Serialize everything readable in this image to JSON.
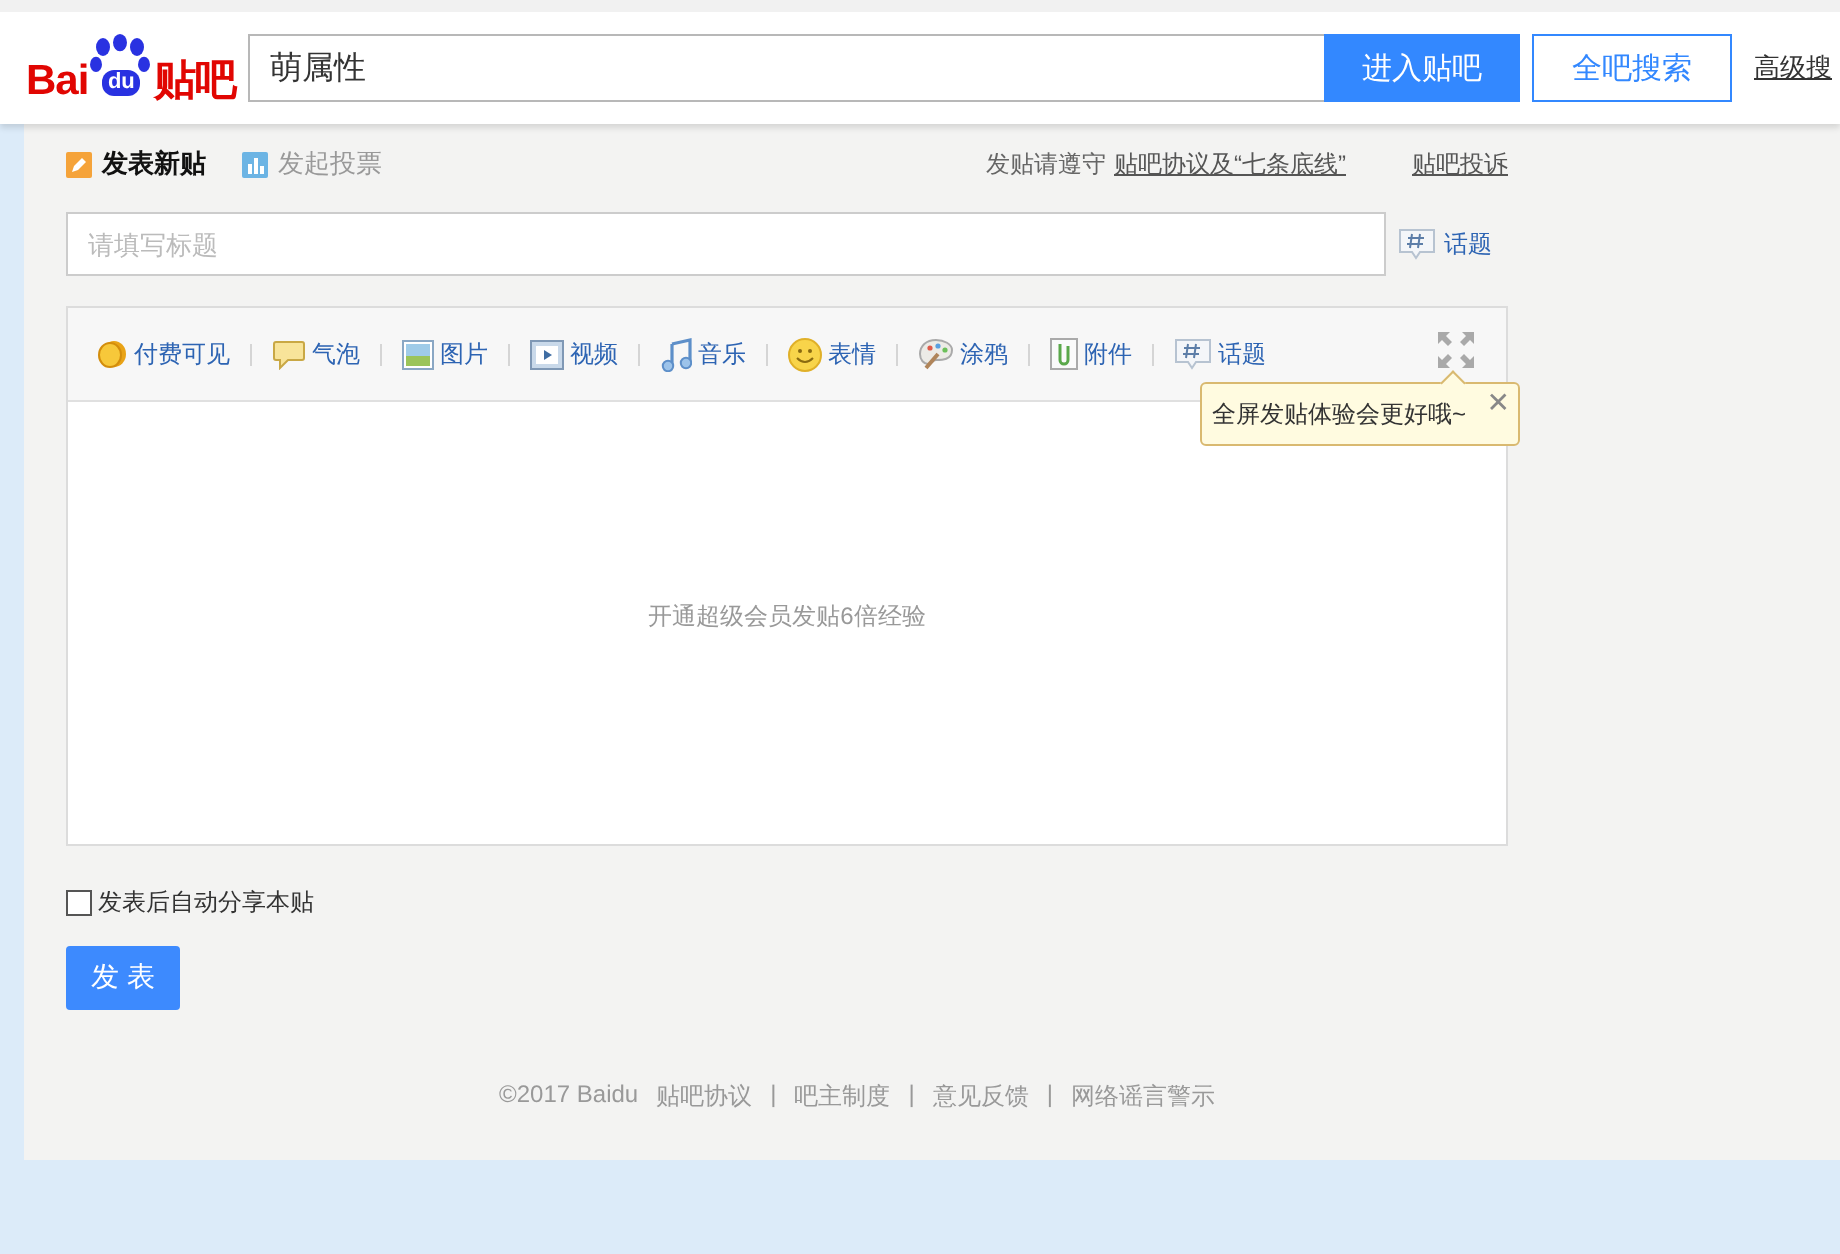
{
  "header": {
    "logo": {
      "left": "Bai",
      "paw": "du",
      "right": "贴吧"
    },
    "search": {
      "value": "萌属性"
    },
    "enter_button": "进入贴吧",
    "search_all_button": "全吧搜索",
    "advanced_link": "高级搜"
  },
  "post_tabs": [
    {
      "label": "发表新贴",
      "selected": true,
      "kind": "post"
    },
    {
      "label": "发起投票",
      "selected": false,
      "kind": "vote"
    }
  ],
  "rules": {
    "prefix": "发贴请遵守",
    "agreement_link": "贴吧协议及“七条底线”",
    "complaint_link": "贴吧投诉"
  },
  "title_field": {
    "placeholder": "请填写标题"
  },
  "topic_button": "话题",
  "toolbar": [
    {
      "label": "付费可见",
      "kind": "coin"
    },
    {
      "label": "气泡",
      "kind": "bubble"
    },
    {
      "label": "图片",
      "kind": "image"
    },
    {
      "label": "视频",
      "kind": "video"
    },
    {
      "label": "音乐",
      "kind": "music"
    },
    {
      "label": "表情",
      "kind": "smiley"
    },
    {
      "label": "涂鸦",
      "kind": "palette"
    },
    {
      "label": "附件",
      "kind": "clip"
    },
    {
      "label": "话题",
      "kind": "topic"
    }
  ],
  "tooltip": {
    "text": "全屏发贴体验会更好哦~",
    "close": "✕"
  },
  "editor": {
    "placeholder": "开通超级会员发贴6倍经验"
  },
  "share_option": {
    "label": "发表后自动分享本贴",
    "checked": false
  },
  "submit_button": "发 表",
  "footer": {
    "copyright": "©2017 Baidu",
    "links": [
      "贴吧协议",
      "吧主制度",
      "意见反馈",
      "网络谣言警示"
    ],
    "separator": "|"
  }
}
